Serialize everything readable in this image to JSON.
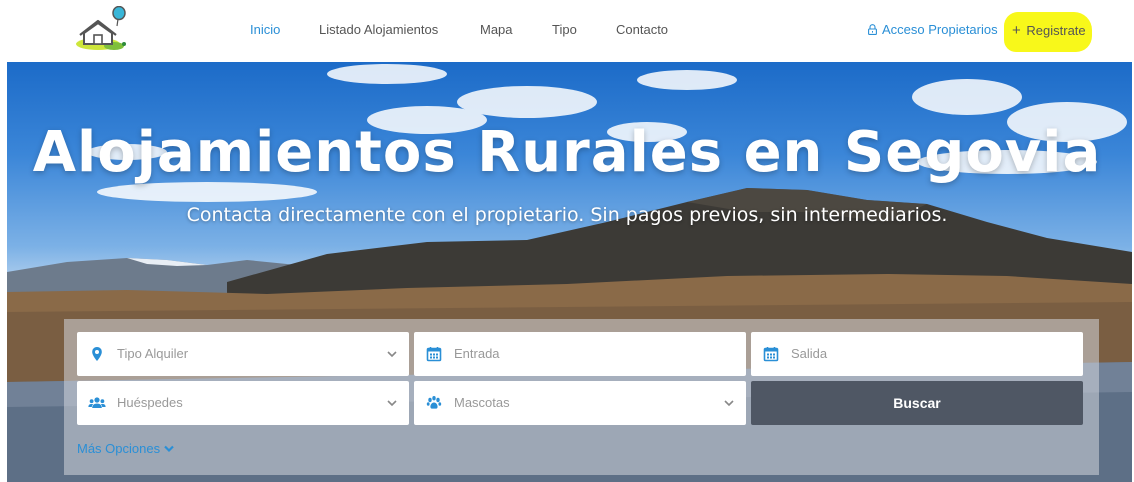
{
  "nav": {
    "items": [
      {
        "label": "Inicio",
        "active": true
      },
      {
        "label": "Listado Alojamientos",
        "active": false
      },
      {
        "label": "Mapa",
        "active": false
      },
      {
        "label": "Tipo",
        "active": false
      },
      {
        "label": "Contacto",
        "active": false
      }
    ],
    "owner_access": "Acceso Propietarios",
    "register": "Registrate",
    "register_prefix": "+"
  },
  "hero": {
    "title": "Alojamientos Rurales en Segovia",
    "subtitle": "Contacta directamente con el propietario. Sin pagos previos, sin intermediarios."
  },
  "search": {
    "rental_type": {
      "placeholder": "Tipo Alquiler",
      "icon": "map-pin-icon"
    },
    "check_in": {
      "placeholder": "Entrada",
      "icon": "calendar-icon"
    },
    "check_out": {
      "placeholder": "Salida",
      "icon": "calendar-icon"
    },
    "guests": {
      "placeholder": "Huéspedes",
      "icon": "users-icon"
    },
    "pets": {
      "placeholder": "Mascotas",
      "icon": "paw-icon"
    },
    "submit": "Buscar",
    "more_options": "Más Opciones"
  },
  "colors": {
    "accent": "#2a8fd6",
    "button_dark": "#4f5764",
    "highlight": "#f8f81a",
    "text_gray": "#555555",
    "placeholder": "#999999"
  }
}
